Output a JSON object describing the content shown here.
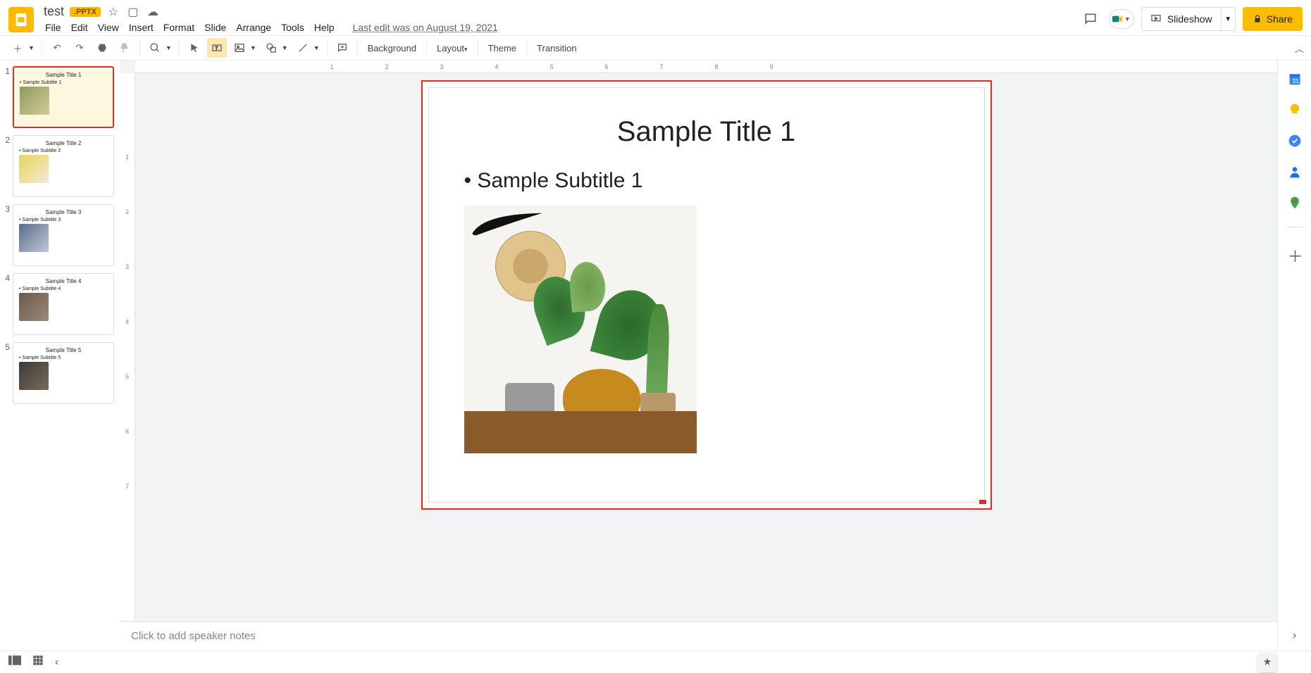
{
  "header": {
    "doc_title": "test",
    "badge": ".PPTX",
    "last_edit": "Last edit was on August 19, 2021",
    "slideshow_label": "Slideshow",
    "share_label": "Share"
  },
  "menu": {
    "file": "File",
    "edit": "Edit",
    "view": "View",
    "insert": "Insert",
    "format": "Format",
    "slide": "Slide",
    "arrange": "Arrange",
    "tools": "Tools",
    "help": "Help"
  },
  "toolbar": {
    "background": "Background",
    "layout": "Layout",
    "theme": "Theme",
    "transition": "Transition"
  },
  "thumbs": [
    {
      "num": "1",
      "title": "Sample Title 1",
      "subtitle": "• Sample Subtitle 1"
    },
    {
      "num": "2",
      "title": "Sample Title 2",
      "subtitle": "• Sample Subtitle 2"
    },
    {
      "num": "3",
      "title": "Sample Title 3",
      "subtitle": "• Sample Subtitle 3"
    },
    {
      "num": "4",
      "title": "Sample Title 4",
      "subtitle": "• Sample Subtitle 4"
    },
    {
      "num": "5",
      "title": "Sample Title 5",
      "subtitle": "• Sample Subtitle 5"
    }
  ],
  "slide": {
    "title": "Sample Title 1",
    "subtitle": "Sample Subtitle 1"
  },
  "ruler_h": [
    "1",
    "2",
    "3",
    "4",
    "5",
    "6",
    "7",
    "8",
    "9"
  ],
  "ruler_v": [
    "1",
    "2",
    "3",
    "4",
    "5",
    "6",
    "7"
  ],
  "notes": {
    "placeholder": "Click to add speaker notes"
  }
}
